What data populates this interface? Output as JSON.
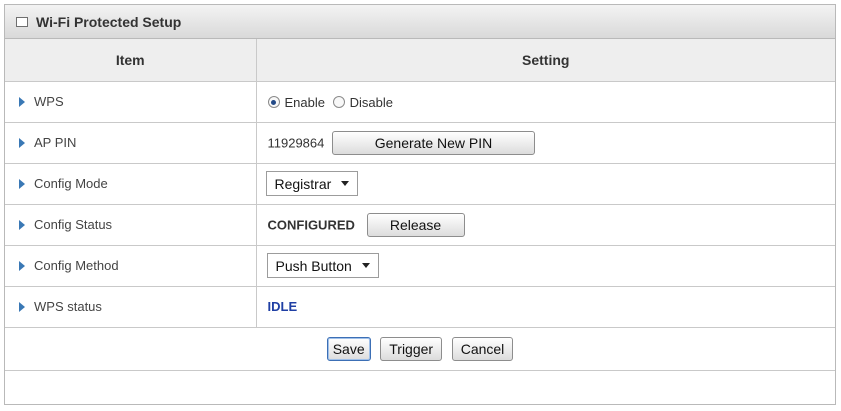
{
  "panel": {
    "title": "Wi-Fi Protected Setup"
  },
  "table": {
    "headers": {
      "item": "Item",
      "setting": "Setting"
    },
    "wps": {
      "label": "WPS",
      "options": [
        {
          "label": "Enable",
          "selected": true
        },
        {
          "label": "Disable",
          "selected": false
        }
      ]
    },
    "ap_pin": {
      "label": "AP PIN",
      "value": "11929864",
      "button": "Generate New PIN"
    },
    "config_mode": {
      "label": "Config Mode",
      "value": "Registrar"
    },
    "config_status": {
      "label": "Config Status",
      "value": "CONFIGURED",
      "button": "Release"
    },
    "config_method": {
      "label": "Config Method",
      "value": "Push Button"
    },
    "wps_status": {
      "label": "WPS status",
      "value": "IDLE"
    }
  },
  "footer": {
    "save": "Save",
    "trigger": "Trigger",
    "cancel": "Cancel"
  },
  "colors": {
    "status_idle": "#1f3fa4",
    "arrow": "#3a78b5"
  }
}
